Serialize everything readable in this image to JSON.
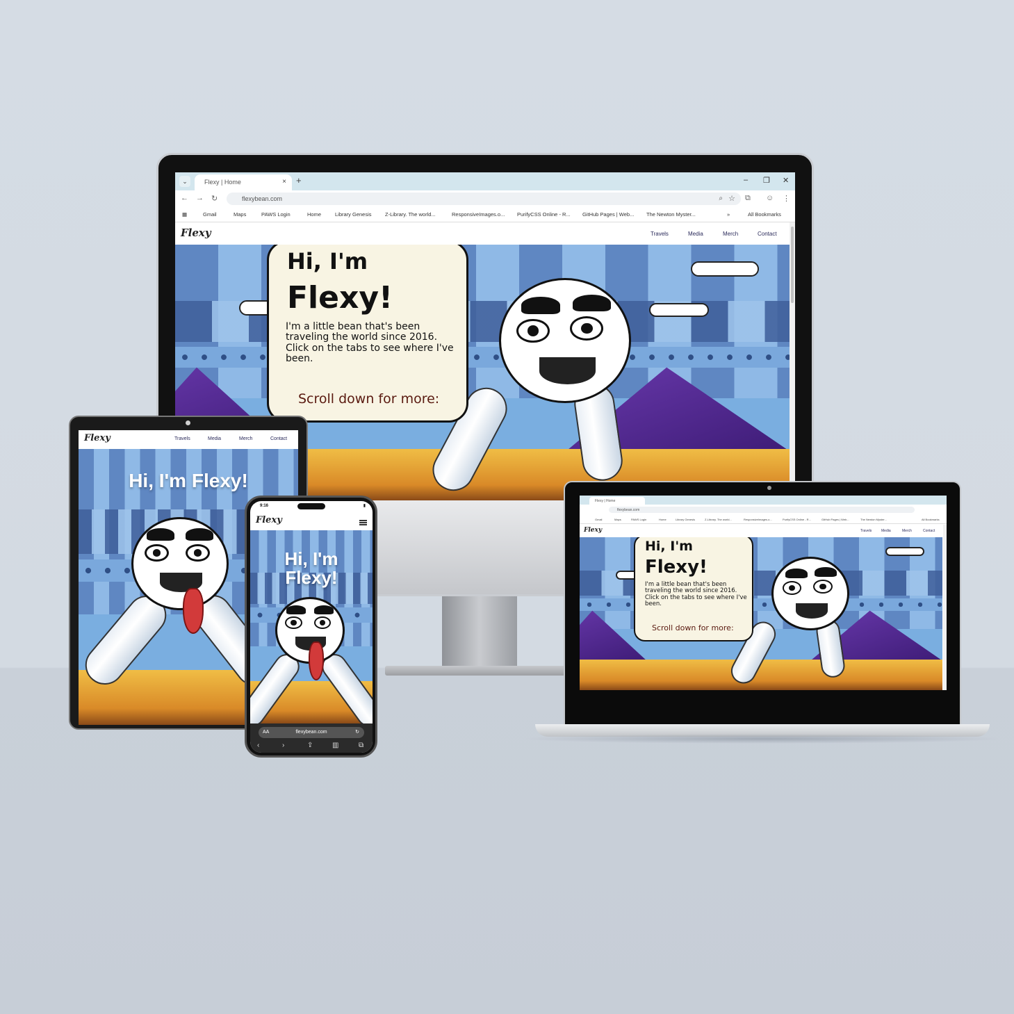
{
  "desktop": {
    "tab_title": "Flexy | Home",
    "url": "flexybean.com",
    "bookmarks": [
      "Gmail",
      "Maps",
      "PAWS Login",
      "Home",
      "Library Genesis",
      "Z-Library. The world...",
      "ResponsiveImages.o...",
      "PurifyCSS Online - R...",
      "GitHub Pages | Web...",
      "The Newton Myster..."
    ],
    "bookmarks_more": "»",
    "all_bookmarks": "All Bookmarks"
  },
  "site": {
    "logo": "Flexy",
    "nav": [
      "Travels",
      "Media",
      "Merch",
      "Contact"
    ],
    "bubble_title_1": "Hi, I'm",
    "bubble_title_2": "Flexy!",
    "bubble_text": "I'm a little bean that's been traveling the world since 2016. Click on the tabs to see where I've been.",
    "bubble_scroll": "Scroll down for more:",
    "hero_heading": "Hi, I'm Flexy!",
    "hero_heading_line1": "Hi, I'm",
    "hero_heading_line2": "Flexy!"
  },
  "phone": {
    "time": "9:16",
    "url_aa": "AA",
    "url": "flexybean.com"
  },
  "icons": {
    "back": "arrow-left-icon",
    "forward": "arrow-right-icon",
    "reload": "reload-icon",
    "star": "star-icon",
    "menu": "hamburger-icon"
  }
}
